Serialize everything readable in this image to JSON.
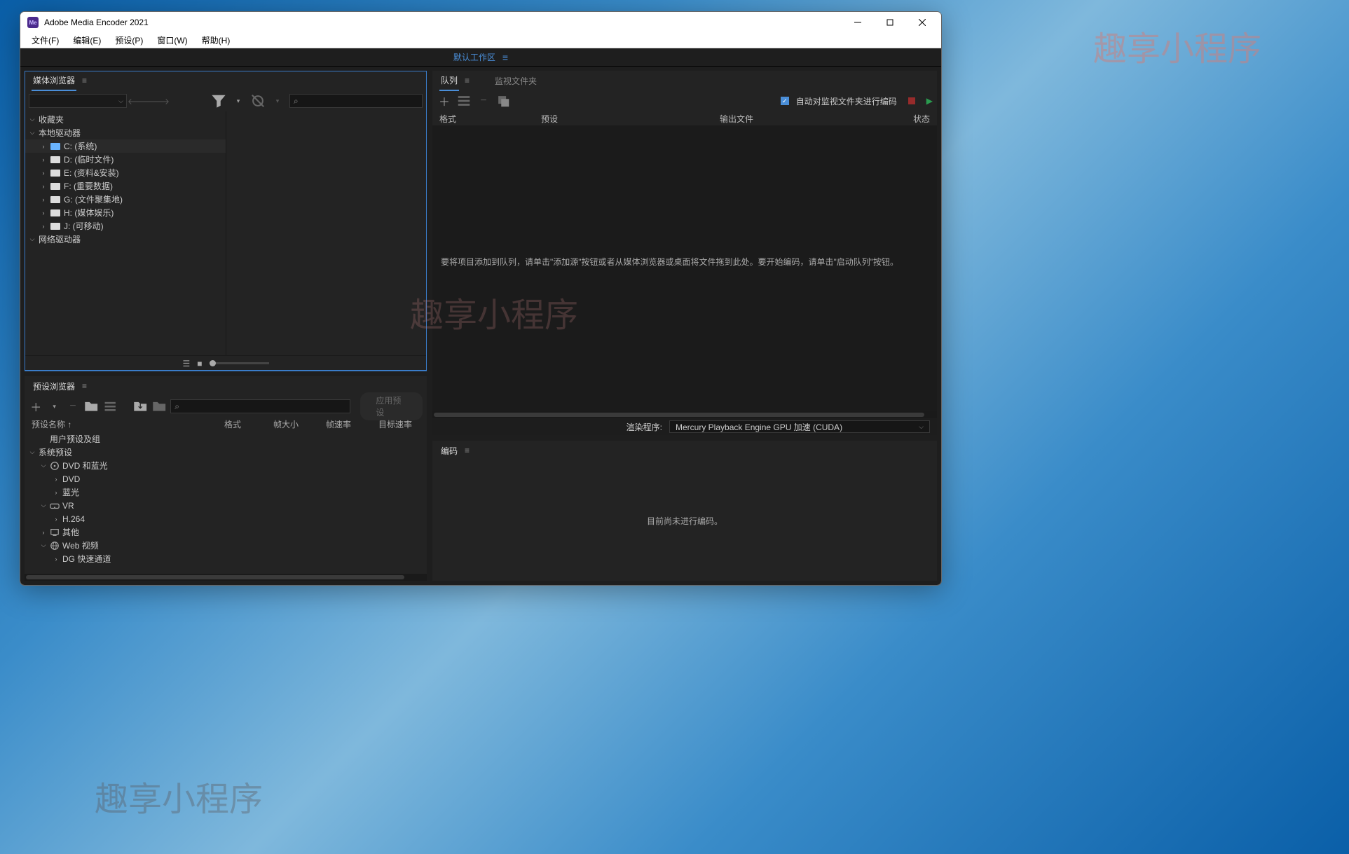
{
  "watermark": "趣享小程序",
  "window": {
    "title": "Adobe Media Encoder 2021",
    "icon_text": "Me"
  },
  "menu": [
    "文件(F)",
    "编辑(E)",
    "预设(P)",
    "窗口(W)",
    "帮助(H)"
  ],
  "workspace": {
    "label": "默认工作区"
  },
  "media_browser": {
    "title": "媒体浏览器",
    "favorites": "收藏夹",
    "local_drives": "本地驱动器",
    "network_drives": "网络驱动器",
    "drives": [
      {
        "label": "C: (系统)",
        "sys": true
      },
      {
        "label": "D: (临时文件)"
      },
      {
        "label": "E: (资料&安装)"
      },
      {
        "label": "F: (重要数据)"
      },
      {
        "label": "G: (文件聚集地)"
      },
      {
        "label": "H: (媒体娱乐)"
      },
      {
        "label": "J: (可移动)"
      }
    ]
  },
  "preset_browser": {
    "title": "预设浏览器",
    "apply_btn": "应用预设",
    "columns": {
      "name": "预设名称 ↑",
      "format": "格式",
      "framesize": "帧大小",
      "fps": "帧速率",
      "target": "目标速率"
    },
    "user_presets": "用户预设及组",
    "system_presets": "系统预设",
    "groups": [
      {
        "label": "DVD 和蓝光",
        "icon": "disc",
        "expanded": true,
        "children": [
          "DVD",
          "蓝光"
        ]
      },
      {
        "label": "VR",
        "icon": "vr",
        "expanded": true,
        "children": [
          "H.264"
        ]
      },
      {
        "label": "其他",
        "icon": "monitor",
        "expanded": false
      },
      {
        "label": "Web 视频",
        "icon": "globe",
        "expanded": true,
        "children": [
          "DG 快速通道"
        ]
      }
    ]
  },
  "queue": {
    "tab_queue": "队列",
    "tab_watch": "监视文件夹",
    "auto_encode_label": "自动对监视文件夹进行编码",
    "columns": {
      "format": "格式",
      "preset": "预设",
      "output": "输出文件",
      "status": "状态"
    },
    "empty_msg": "要将项目添加到队列，请单击\"添加源\"按钮或者从媒体浏览器或桌面将文件拖到此处。要开始编码，请单击\"启动队列\"按钮。",
    "render_label": "渲染程序:",
    "render_engine": "Mercury Playback Engine GPU 加速 (CUDA)"
  },
  "encoding": {
    "title": "编码",
    "idle_msg": "目前尚未进行编码。"
  }
}
